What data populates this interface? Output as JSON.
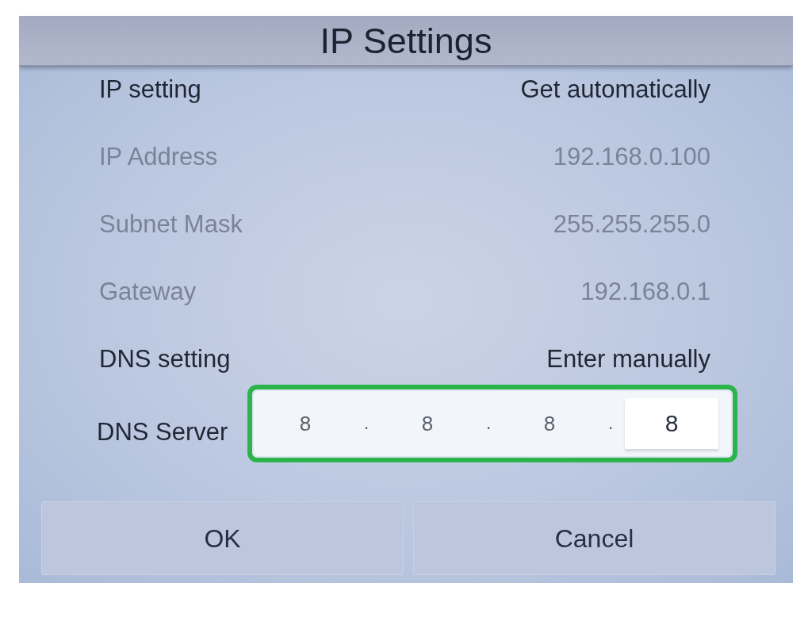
{
  "window": {
    "title": "IP Settings"
  },
  "settings": [
    {
      "label": "IP setting",
      "value": "Get automatically",
      "disabled": false
    },
    {
      "label": "IP Address",
      "value": "192.168.0.100",
      "disabled": true
    },
    {
      "label": "Subnet Mask",
      "value": "255.255.255.0",
      "disabled": true
    },
    {
      "label": "Gateway",
      "value": "192.168.0.1",
      "disabled": true
    },
    {
      "label": "DNS setting",
      "value": "Enter manually",
      "disabled": false
    }
  ],
  "dns_server": {
    "label": "DNS Server",
    "highlighted": true,
    "octets": [
      {
        "value": "8",
        "selected": false
      },
      {
        "value": "8",
        "selected": false
      },
      {
        "value": "8",
        "selected": false
      },
      {
        "value": "8",
        "selected": true
      }
    ],
    "separators": [
      ".",
      ".",
      "."
    ]
  },
  "buttons": [
    "OK",
    "Cancel"
  ]
}
